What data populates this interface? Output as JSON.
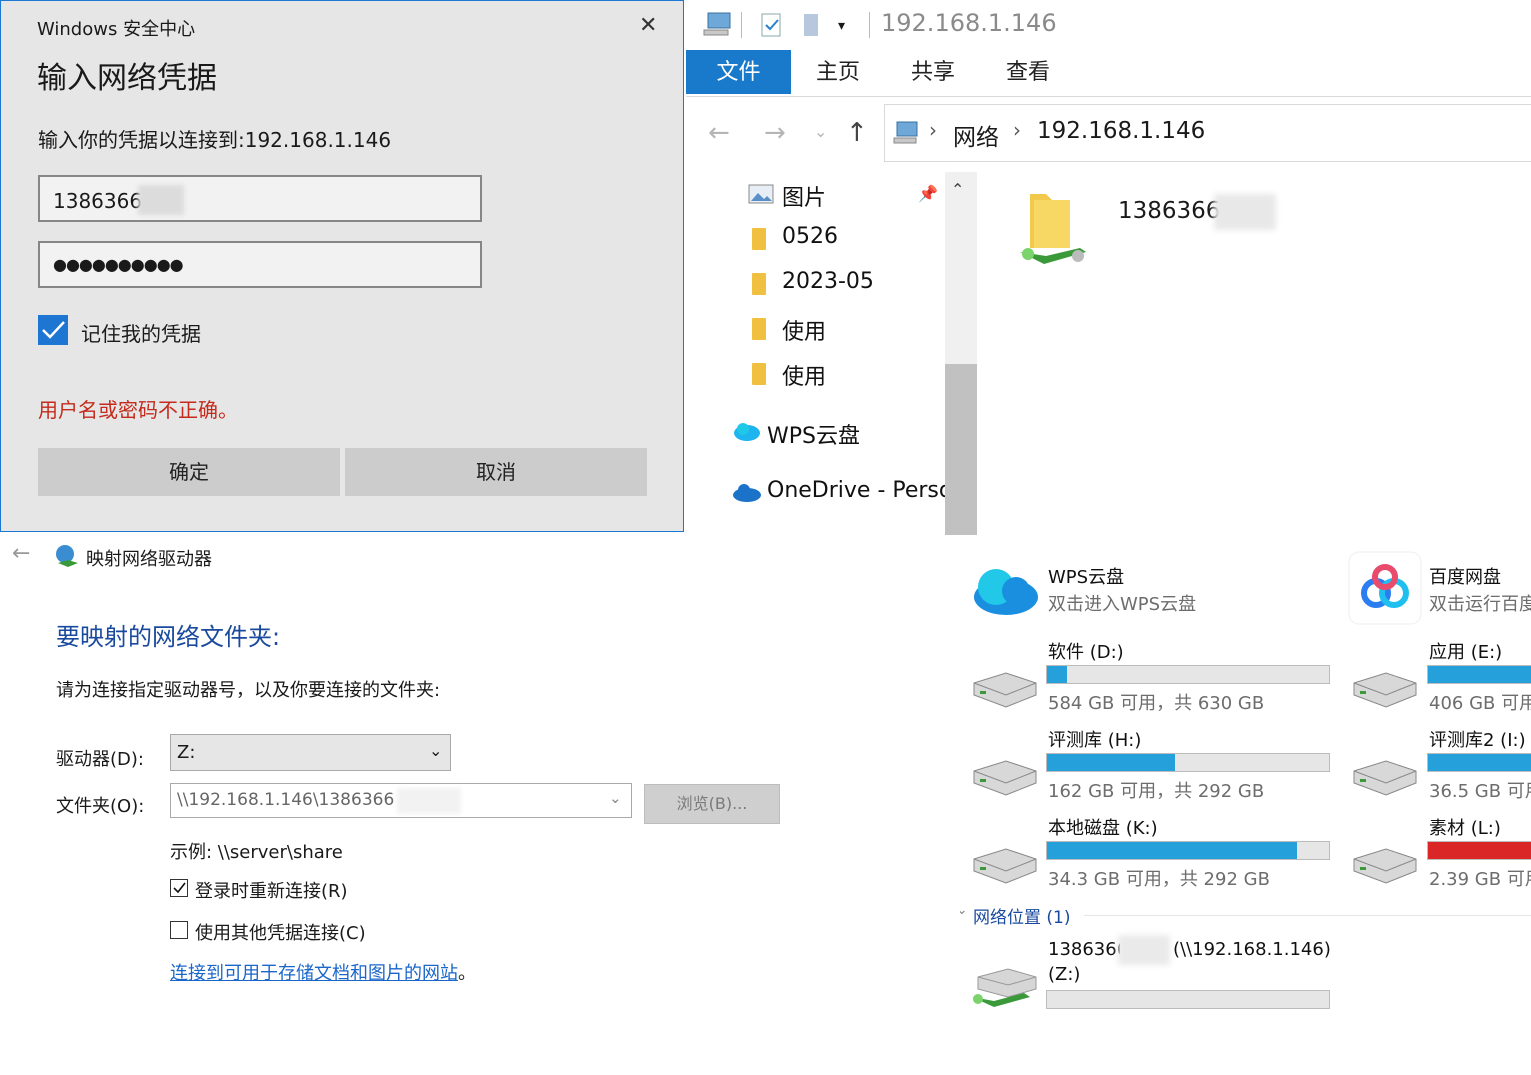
{
  "explorer": {
    "address_text": "192.168.1.146",
    "ribbon_tabs": [
      "文件",
      "主页",
      "共享",
      "查看"
    ],
    "breadcrumb": [
      "网络",
      "192.168.1.146"
    ],
    "nav_items": [
      "图片",
      "0526",
      "2023-05",
      "使用",
      "使用",
      "WPS云盘",
      "OneDrive - Perso"
    ],
    "content_item": "1386366"
  },
  "credential_dialog": {
    "window_title": "Windows 安全中心",
    "heading": "输入网络凭据",
    "prompt": "输入你的凭据以连接到:192.168.1.146",
    "username": "13863660",
    "password_mask": "●●●●●●●●●●",
    "remember_label": "记住我的凭据",
    "error": "用户名或密码不正确。",
    "ok_label": "确定",
    "cancel_label": "取消",
    "close_glyph": "✕"
  },
  "map_drive": {
    "window_title": "映射网络驱动器",
    "heading": "要映射的网络文件夹:",
    "instruction": "请为连接指定驱动器号，以及你要连接的文件夹:",
    "drive_label": "驱动器(D):",
    "drive_value": "Z:",
    "folder_label": "文件夹(O):",
    "folder_value": "\\\\192.168.1.146\\1386366",
    "browse_label": "浏览(B)...",
    "example": "示例: \\\\server\\share",
    "reconnect_label": "登录时重新连接(R)",
    "other_cred_label": "使用其他凭据连接(C)",
    "link": "连接到可用于存储文档和图片的网站",
    "link_suffix": "。"
  },
  "this_pc": {
    "clouds": [
      {
        "name": "WPS云盘",
        "sub": "双击进入WPS云盘"
      },
      {
        "name": "百度网盘",
        "sub": "双击运行百度"
      }
    ],
    "drives": [
      {
        "name": "软件 (D:)",
        "sub": "584 GB 可用，共 630 GB",
        "used": 0.07
      },
      {
        "name": "应用 (E:)",
        "sub": "406 GB 可用",
        "used": 0.4
      },
      {
        "name": "评测库 (H:)",
        "sub": "162 GB 可用，共 292 GB",
        "used": 0.45
      },
      {
        "name": "评测库2 (I:)",
        "sub": "36.5 GB 可用",
        "used": 0.9
      },
      {
        "name": "本地磁盘 (K:)",
        "sub": "34.3 GB 可用，共 292 GB",
        "used": 0.88
      },
      {
        "name": "素材 (L:)",
        "sub": "2.39 GB 可用",
        "used": 0.98
      }
    ],
    "network_section": "网络位置 (1)",
    "network_item_name": "1386366",
    "network_item_host": "(\\\\192.168.1.146)",
    "network_item_drive": "(Z:)"
  },
  "colors": {
    "accent": "#1979ca",
    "bar_fill": "#26a0da",
    "bar_full": "#da2626",
    "error": "#c42b1c",
    "link": "#1a66c9"
  }
}
